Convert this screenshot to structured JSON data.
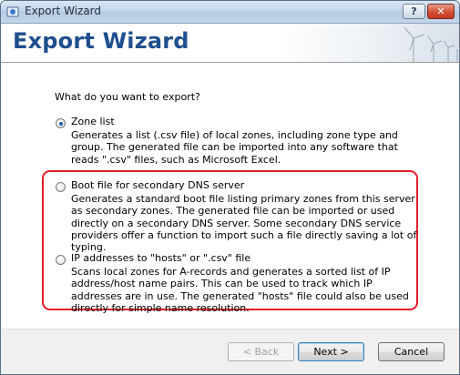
{
  "window": {
    "title": "Export Wizard"
  },
  "titlebar": {
    "help_label": "?",
    "close_label": "✕"
  },
  "header": {
    "title": "Export Wizard"
  },
  "question": "What do you want to export?",
  "options": [
    {
      "label": "Zone list",
      "selected": true,
      "description": "Generates a list (.csv file) of local zones, including zone type and group. The generated file can be imported into any software that reads \".csv\" files, such as Microsoft Excel."
    },
    {
      "label": "Boot file for secondary DNS server",
      "selected": false,
      "description": "Generates a standard boot file listing primary zones from this server as secondary zones. The generated file can be imported or used directly on a secondary DNS server. Some secondary DNS service providers offer a function to import such a file directly saving a lot of typing."
    },
    {
      "label": "IP addresses to \"hosts\" or \".csv\" file",
      "selected": false,
      "description": "Scans local zones for A-records and generates a sorted list of IP address/host name pairs. This can be used to track which IP addresses are in use. The generated \"hosts\" file could also be used directly for simple name resolution."
    }
  ],
  "buttons": {
    "back": "< Back",
    "next": "Next >",
    "cancel": "Cancel"
  },
  "colors": {
    "header_title": "#1f4f8e",
    "highlight_border": "#e01c2a"
  }
}
